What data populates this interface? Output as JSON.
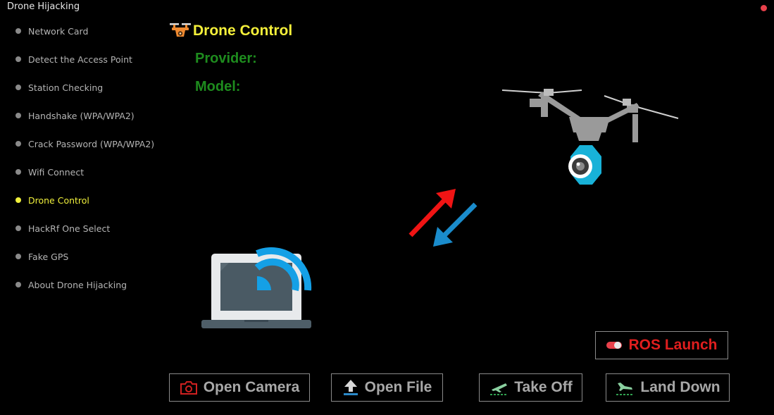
{
  "window": {
    "title": "Drone Hijacking"
  },
  "sidebar": {
    "items": [
      {
        "label": "Network Card"
      },
      {
        "label": "Detect the Access Point"
      },
      {
        "label": "Station Checking"
      },
      {
        "label": "Handshake (WPA/WPA2)"
      },
      {
        "label": "Crack Password (WPA/WPA2)"
      },
      {
        "label": "Wifi Connect"
      },
      {
        "label": "Drone Control",
        "active": true
      },
      {
        "label": "HackRf One Select"
      },
      {
        "label": "Fake GPS"
      },
      {
        "label": "About Drone Hijacking"
      }
    ]
  },
  "main": {
    "title": "Drone Control",
    "provider_label": "Provider:",
    "model_label": "Model:"
  },
  "buttons": {
    "ros_launch": "ROS Launch",
    "open_camera": "Open Camera",
    "open_file": "Open File",
    "take_off": "Take Off",
    "land_down": "Land Down"
  },
  "colors": {
    "accent_yellow": "#f5f03a",
    "label_green": "#1e8c1e",
    "ros_red": "#e01e1e",
    "wifi_blue": "#14a0e6",
    "arrow_red": "#f01414",
    "arrow_blue": "#1a8ccc"
  },
  "icons": {
    "title": "drone-icon",
    "laptop": "laptop-wifi-icon",
    "arrows": "transfer-arrows-icon",
    "drone": "drone-camera-icon",
    "ros": "toggle-icon",
    "camera": "camera-icon",
    "file": "upload-icon",
    "takeoff": "airplane-takeoff-icon",
    "land": "airplane-landing-icon"
  }
}
